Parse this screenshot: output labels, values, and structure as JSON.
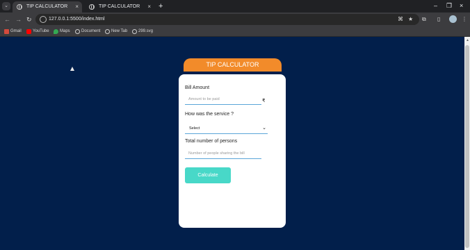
{
  "browser": {
    "tabs": [
      {
        "title": "TIP CALCULATOR",
        "active": true
      },
      {
        "title": "TIP CALCULATOR",
        "active": false
      }
    ],
    "url": "127.0.0.1:5500/index.html",
    "bookmarks": [
      "Gmail",
      "YouTube",
      "Maps",
      "Document",
      "New Tab",
      "299.svg"
    ]
  },
  "app": {
    "title": "TIP CALCULATOR",
    "bill_label": "Bill Amount",
    "bill_placeholder": "Amount to be paid",
    "currency_symbol": "₹",
    "service_label": "How was the service ?",
    "service_selected": "Select",
    "persons_label": "Total number of persons",
    "persons_placeholder": "Number of people sharing the bill",
    "calculate_label": "Calculate"
  },
  "colors": {
    "page_bg": "#021f4b",
    "title_bg": "#f28b2a",
    "button_bg": "#48d8c8",
    "input_underline": "#5aa5d8"
  }
}
